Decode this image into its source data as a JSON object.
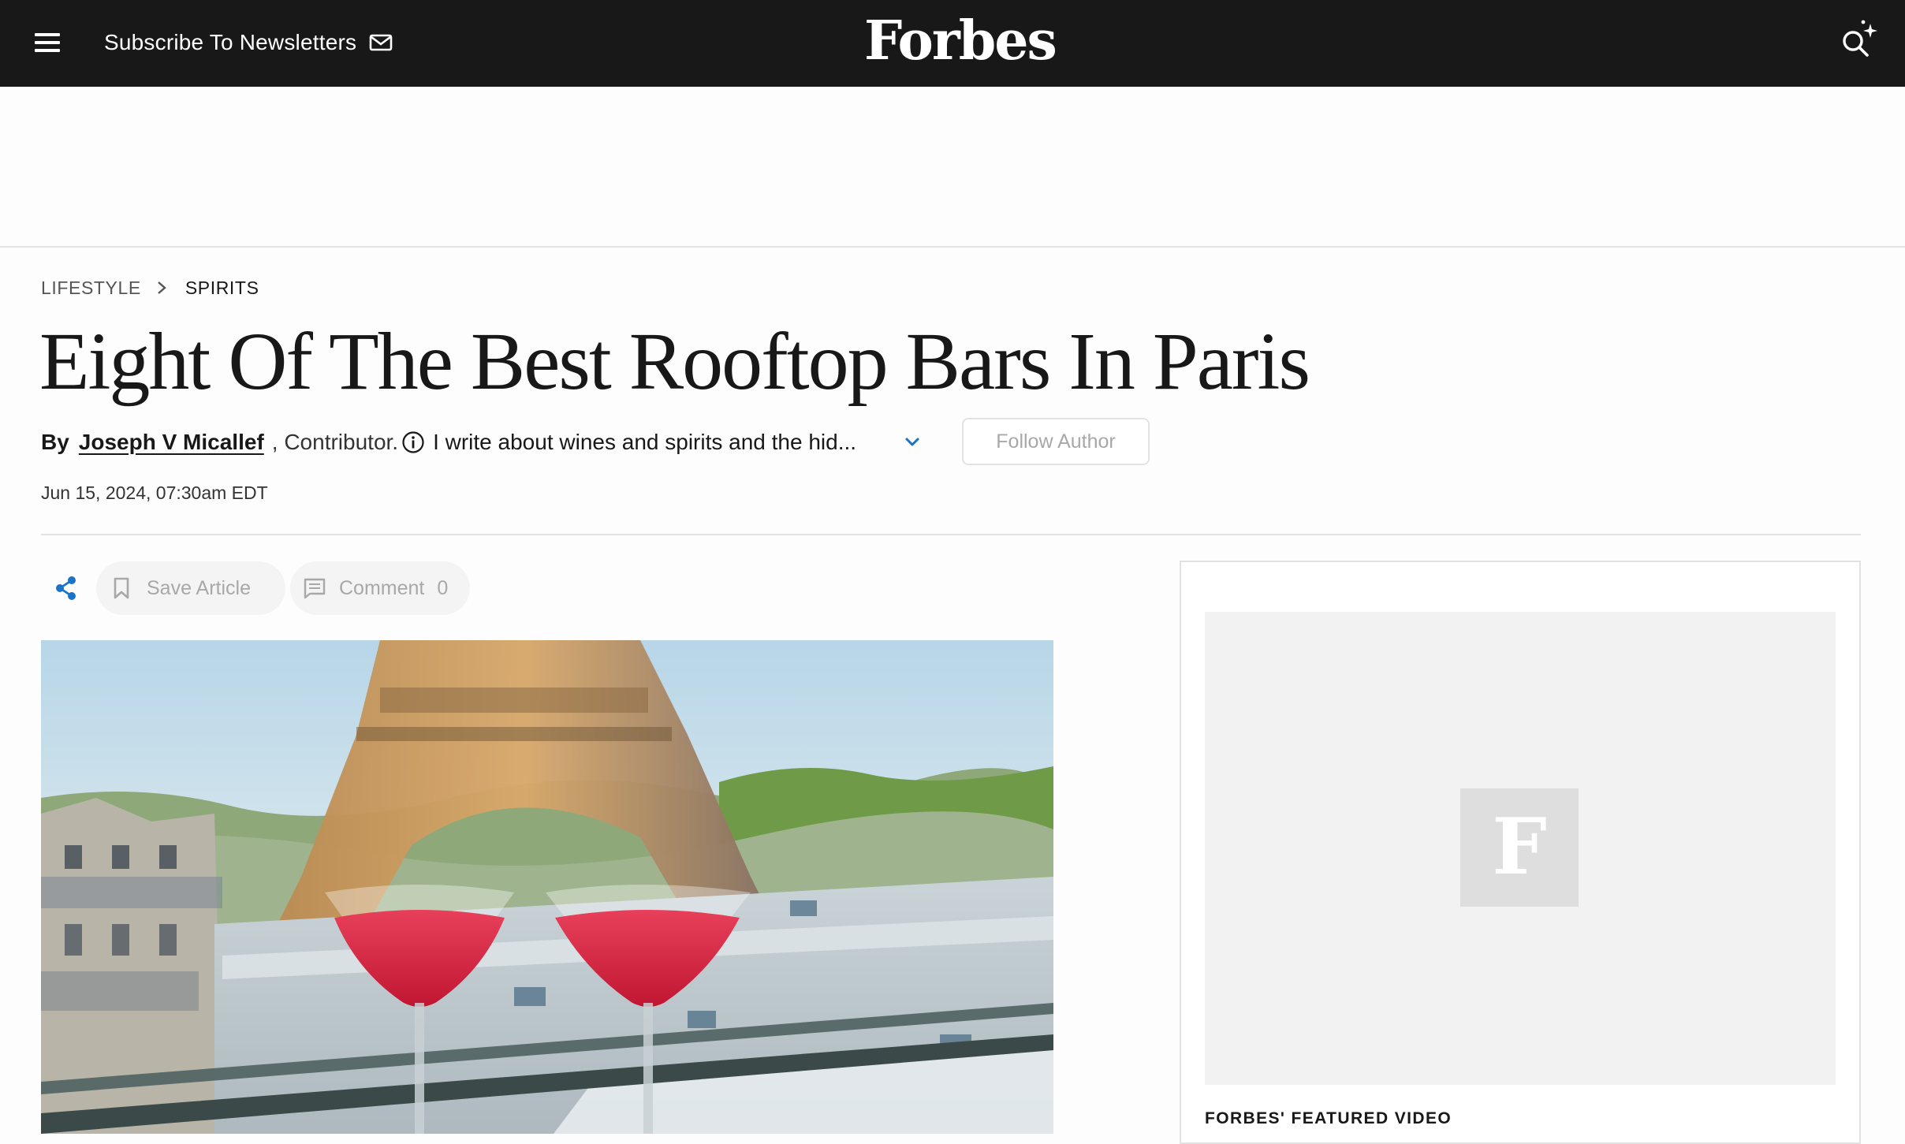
{
  "nav": {
    "subscribe_label": "Subscribe To Newsletters",
    "logo_text": "Forbes"
  },
  "breadcrumb": {
    "section": "LIFESTYLE",
    "subsection": "SPIRITS"
  },
  "article": {
    "headline": "Eight Of The Best Rooftop Bars In Paris",
    "by_label": "By",
    "author": "Joseph V Micallef",
    "role": ", Contributor.",
    "bio": "I write about wines and spirits and the hid...",
    "follow_label": "Follow Author",
    "date": "Jun 15, 2024, 07:30am EDT"
  },
  "actions": {
    "save_label": "Save Article",
    "comment_label": "Comment",
    "comment_count": "0"
  },
  "sidebar": {
    "video_logo_letter": "F",
    "video_title": "FORBES' FEATURED VIDEO"
  },
  "icons": {
    "menu": "hamburger-menu-icon",
    "mail": "mail-icon",
    "search": "search-sparkle-icon",
    "breadcrumb_separator": "chevron-right-icon",
    "info": "info-icon",
    "expand": "chevron-down-icon",
    "share": "share-icon",
    "bookmark": "bookmark-icon",
    "comment": "comment-icon"
  },
  "colors": {
    "nav_background": "#181818",
    "accent_blue": "#1a73c7",
    "muted_text": "#a8a8a8",
    "divider": "#e2e2e2"
  }
}
